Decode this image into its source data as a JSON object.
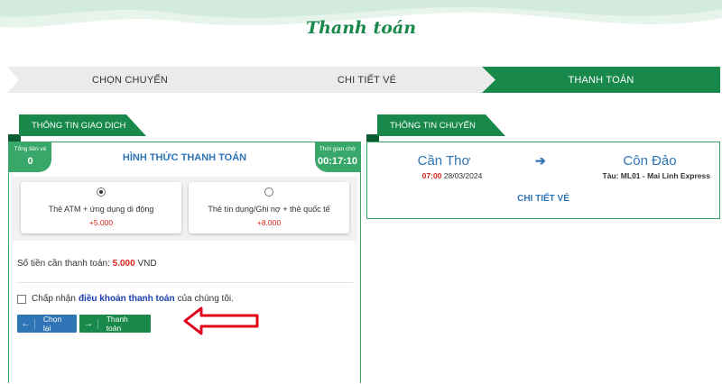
{
  "page": {
    "title": "Thanh toán"
  },
  "steps": [
    {
      "label": "CHỌN CHUYẾN",
      "active": false
    },
    {
      "label": "CHI TIẾT VÉ",
      "active": false
    },
    {
      "label": "THANH TOÁN",
      "active": true
    }
  ],
  "transaction": {
    "header": "THÔNG TIN GIAO DỊCH",
    "total_label": "Tổng tiền vé",
    "total_value": "0",
    "timer_label": "Thời gian chờ",
    "timer_value": "00:17:10",
    "method_title": "HÌNH THỨC THANH TOÁN",
    "methods": [
      {
        "name": "Thẻ ATM + ứng dụng di động",
        "fee": "+5.000",
        "selected": true
      },
      {
        "name": "Thẻ tín dụng/Ghi nợ + thẻ quốc tế",
        "fee": "+8.000",
        "selected": false
      }
    ],
    "amount_label": "Số tiền cần thanh toán:",
    "amount_value": "5.000",
    "amount_unit": "VND",
    "terms_prefix": "Chấp nhận",
    "terms_link": "điều khoản thanh toán",
    "terms_suffix": "của chúng tôi.",
    "terms_checked": false,
    "back_label": "Chọn lại",
    "pay_label": "Thanh toán"
  },
  "trip": {
    "header": "THÔNG TIN CHUYẾN",
    "from": "Cần Thơ",
    "to": "Côn Đảo",
    "depart_time": "07:00",
    "depart_date": "28/03/2024",
    "train": "Tàu: ML01 - Mai Linh Express",
    "detail_link": "CHI TIẾT VÉ"
  },
  "colors": {
    "brand_green": "#18894a",
    "panel_green": "#38a86a",
    "link_blue": "#2f75b5",
    "price_red": "#d9261c",
    "annotation_red": "#e0001a"
  },
  "icons": {
    "direction_arrow": "arrow-right-icon",
    "back": "arrow-left-icon",
    "pay": "arrow-right-icon",
    "annotation": "red-outline-arrow-left"
  }
}
